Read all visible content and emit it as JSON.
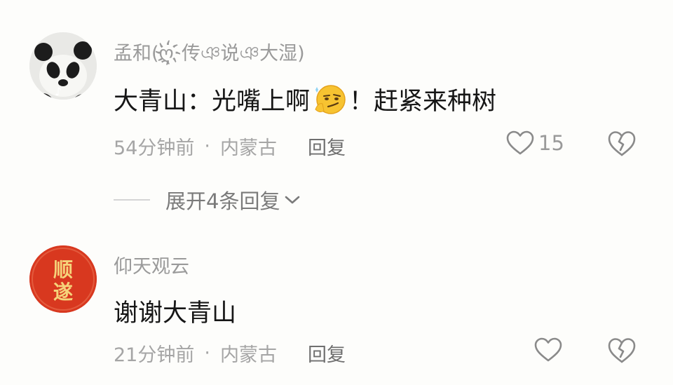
{
  "comments": [
    {
      "author": "孟和(ღ҉传ঞ说ঞ大湿)",
      "text_before": "大青山：光嘴上啊",
      "text_after": "！赶紧来种树",
      "emoji": "smirk-emoji",
      "time": "54分钟前",
      "separator": "·",
      "location": "内蒙古",
      "reply_label": "回复",
      "like_count": "15",
      "expand_label": "展开4条回复"
    },
    {
      "author": "仰天观云",
      "text": "谢谢大青山",
      "time": "21分钟前",
      "separator": "·",
      "location": "内蒙古",
      "reply_label": "回复",
      "avatar_text": "顺遂"
    }
  ],
  "colors": {
    "background": "#fdfdfb",
    "meta": "#a5a5a5",
    "avatar_red": "#d8381f",
    "avatar_text": "#f5d37a"
  }
}
